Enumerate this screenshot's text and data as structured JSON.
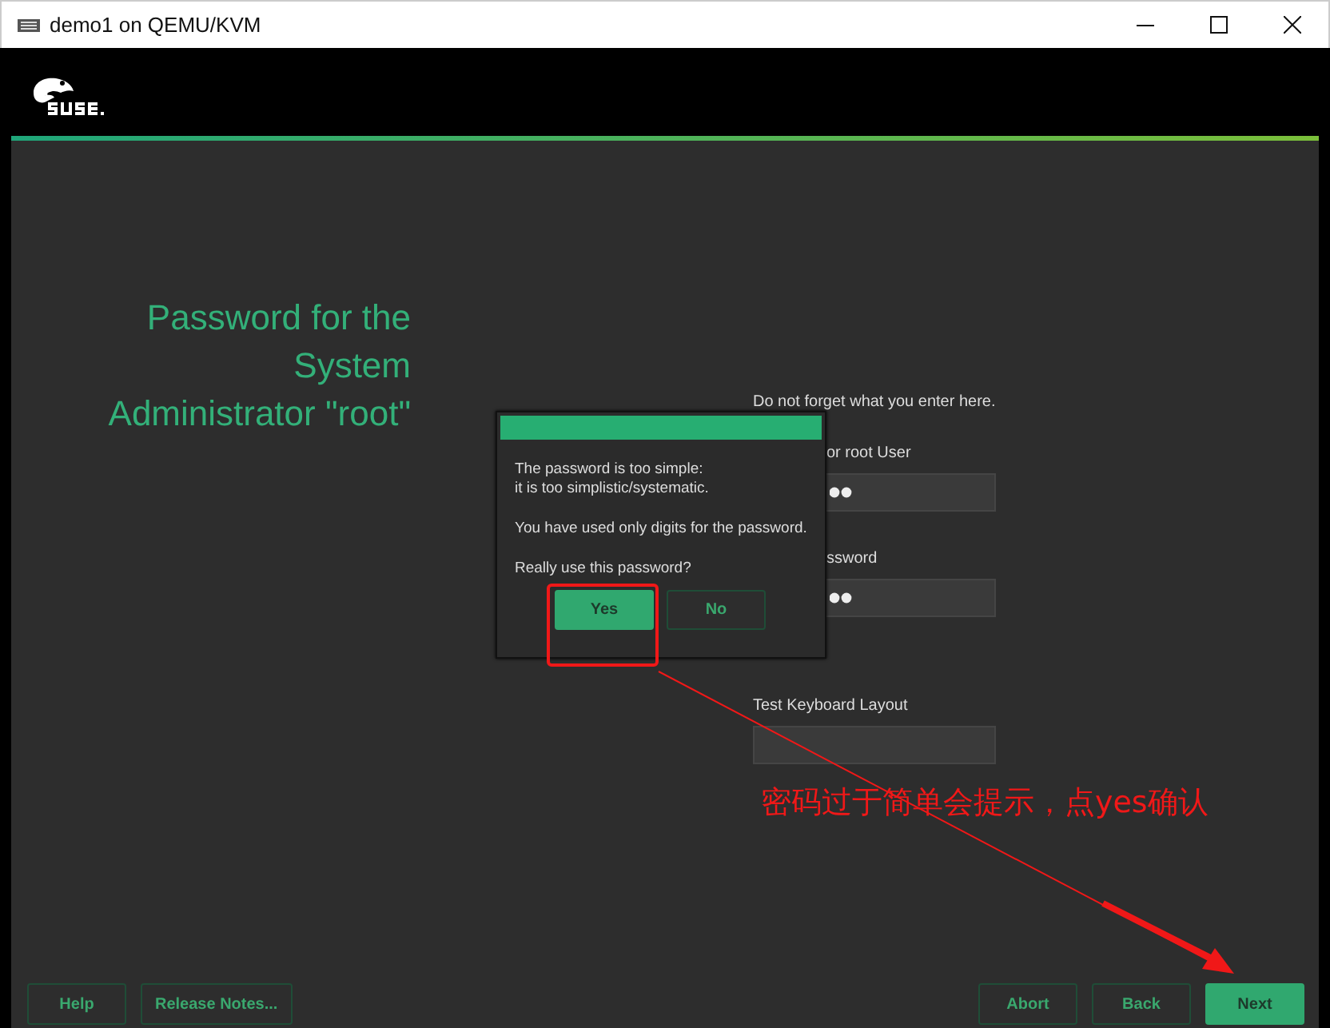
{
  "window": {
    "title": "demo1 on QEMU/KVM"
  },
  "page_title": "Password for the\nSystem\nAdministrator \"root\"",
  "hint": "Do not forget what you enter here.",
  "fields": [
    {
      "label": "or root User",
      "kind": "password"
    },
    {
      "label": "ssword",
      "kind": "password"
    },
    {
      "label": "Test Keyboard Layout",
      "kind": "text"
    }
  ],
  "dialog": {
    "lines": [
      "The password is too simple:\nit is too simplistic/systematic.",
      "You have used only digits for the password.",
      "Really use this password?"
    ],
    "buttons": [
      {
        "label": "Yes",
        "selected": true
      },
      {
        "label": "No",
        "selected": false
      }
    ]
  },
  "buttons_left": [
    {
      "label": "Help"
    },
    {
      "label": "Release Notes..."
    }
  ],
  "buttons_right": [
    {
      "label": "Abort",
      "kind": "plain"
    },
    {
      "label": "Back",
      "kind": "plain"
    },
    {
      "label": "Next",
      "kind": "primary"
    }
  ],
  "annotation": {
    "text": "密码过于简单会提示，点yes确认"
  }
}
